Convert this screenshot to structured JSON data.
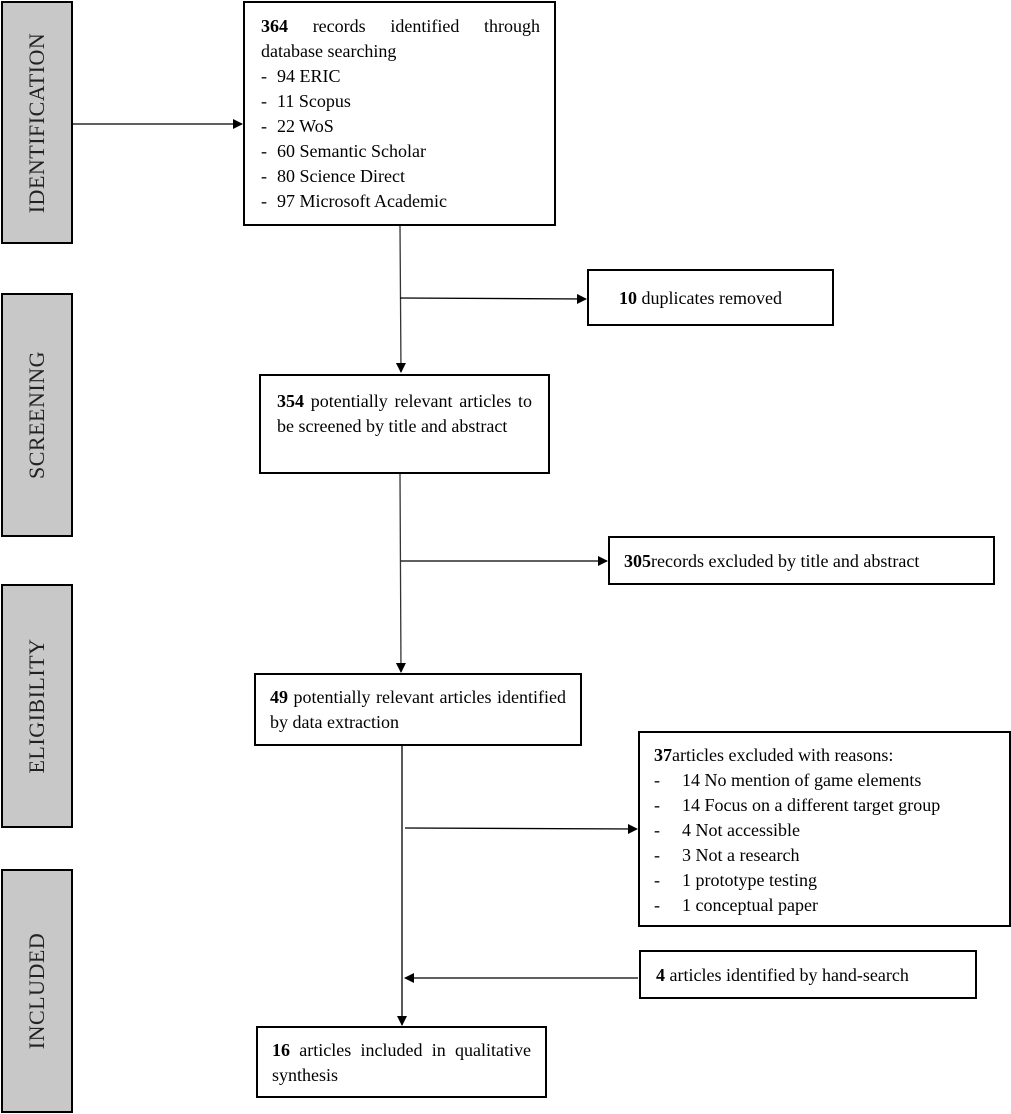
{
  "phases": [
    {
      "label": "IDENTIFICATION"
    },
    {
      "label": "SCREENING"
    },
    {
      "label": "ELIGIBILITY"
    },
    {
      "label": "INCLUDED"
    }
  ],
  "identification": {
    "count": "364",
    "text": "records identified through database searching",
    "sources": [
      {
        "dash": "-",
        "text": "94 ERIC"
      },
      {
        "dash": "-",
        "text": "11 Scopus"
      },
      {
        "dash": "-",
        "text": "22 WoS"
      },
      {
        "dash": "-",
        "text": "60 Semantic Scholar"
      },
      {
        "dash": "-",
        "text": "80 Science Direct"
      },
      {
        "dash": "-",
        "text": "97 Microsoft Academic"
      }
    ]
  },
  "duplicates": {
    "count": "10",
    "text": "duplicates removed"
  },
  "screening": {
    "count": "354",
    "text": "potentially relevant articles to be screened by title and abstract"
  },
  "excluded_title": {
    "count": "305",
    "text": "records excluded by title and abstract"
  },
  "eligibility": {
    "count": "49",
    "text": "potentially relevant articles identified by data extraction"
  },
  "excluded_reasons": {
    "count": "37",
    "text": "articles excluded with reasons:",
    "reasons": [
      {
        "dash": "-",
        "text": "14 No mention of game elements"
      },
      {
        "dash": "-",
        "text": "14 Focus on a different target group"
      },
      {
        "dash": "-",
        "text": "4 Not accessible"
      },
      {
        "dash": "-",
        "text": "3 Not a research"
      },
      {
        "dash": "-",
        "text": "1 prototype testing"
      },
      {
        "dash": "-",
        "text": "1 conceptual paper"
      }
    ]
  },
  "hand_search": {
    "count": "4",
    "text": "articles identified by hand-search"
  },
  "included": {
    "count": "16",
    "text": "articles included in qualitative synthesis"
  }
}
